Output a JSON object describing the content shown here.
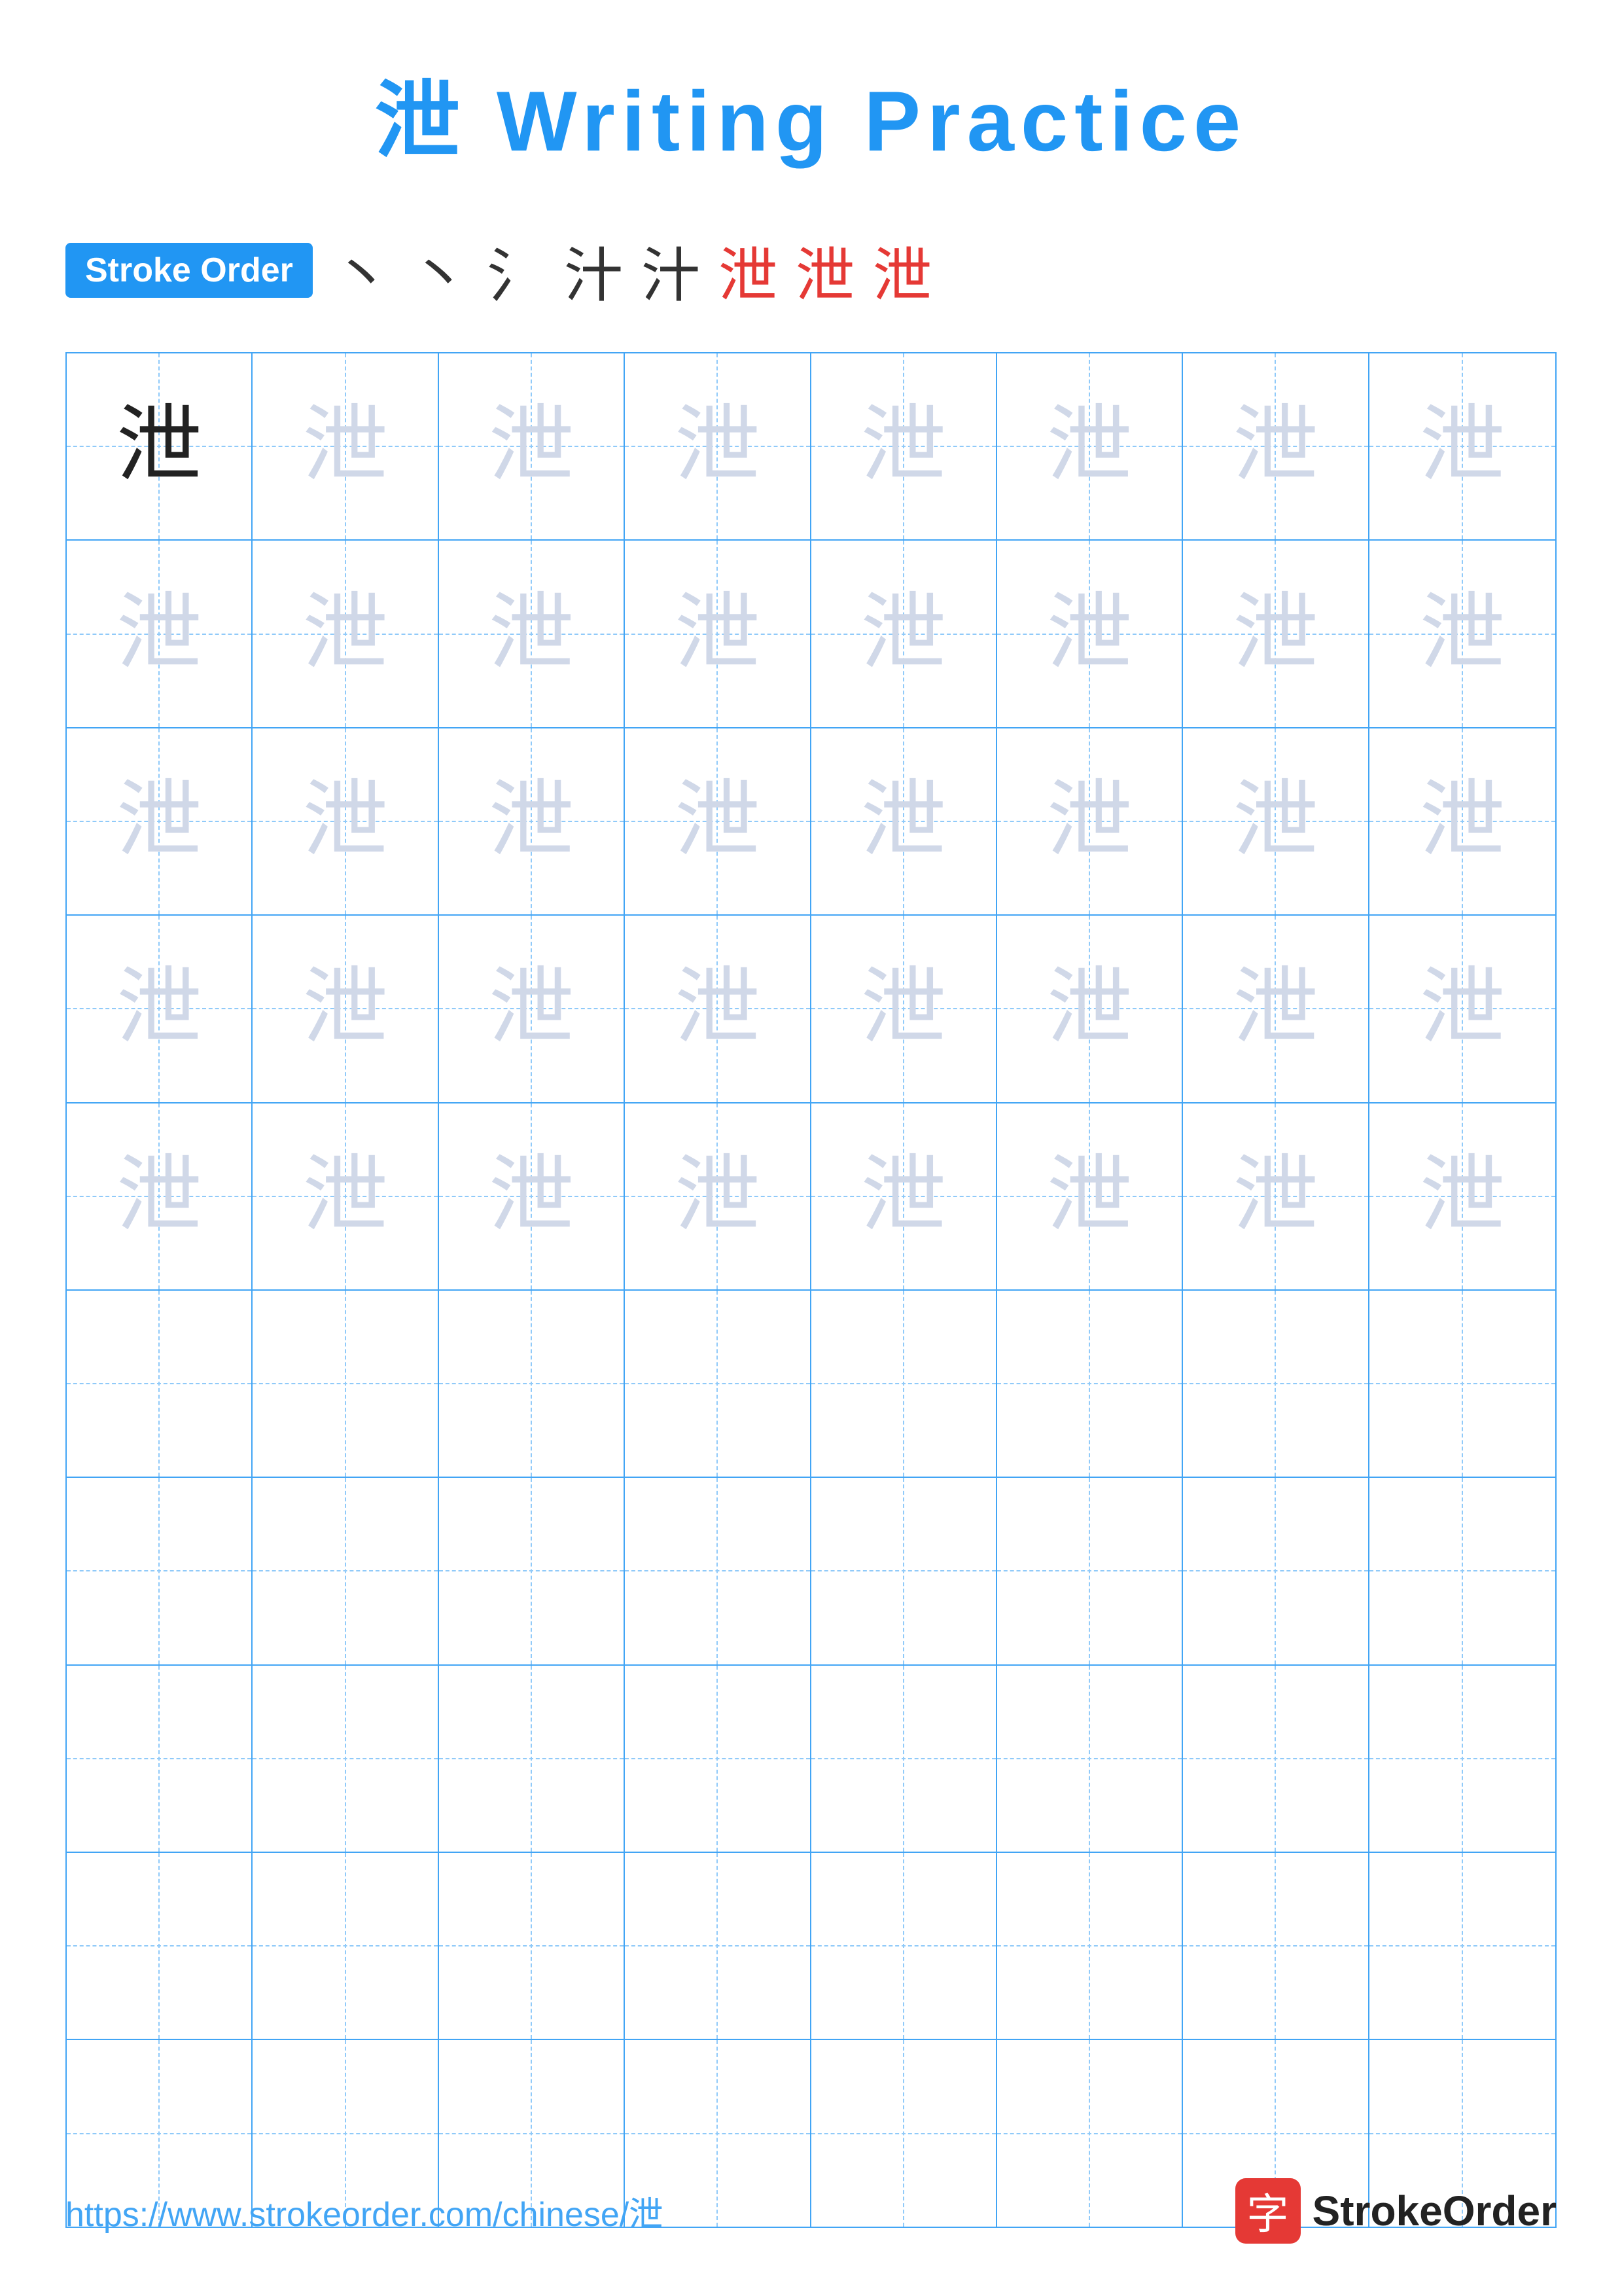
{
  "title": {
    "char": "泄",
    "label": "Writing Practice"
  },
  "stroke_order": {
    "badge_label": "Stroke Order",
    "strokes": [
      "丶",
      "丶",
      "氵",
      "汁",
      "汁",
      "泄",
      "泄",
      "泄"
    ]
  },
  "grid": {
    "rows": 10,
    "cols": 8,
    "practice_char": "泄",
    "filled_rows": 5,
    "empty_rows": 5
  },
  "footer": {
    "url": "https://www.strokeorder.com/chinese/泄",
    "logo_char": "字",
    "logo_text": "StrokeOrder"
  },
  "colors": {
    "blue": "#2196F3",
    "blue_light": "#42A5F5",
    "red": "#e53935",
    "dark": "#222222",
    "light_char": "#d0d8e8"
  }
}
